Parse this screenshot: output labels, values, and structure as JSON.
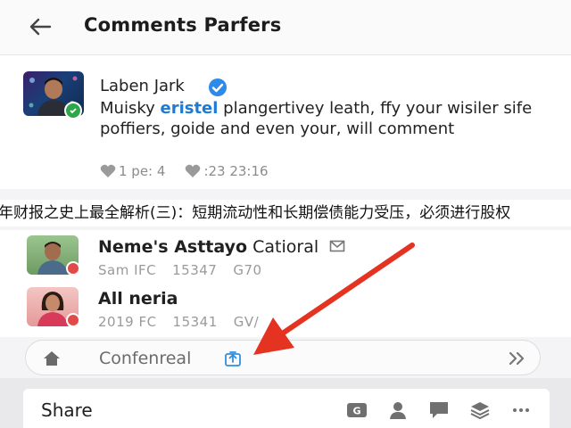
{
  "header": {
    "title": "Comments Parfers"
  },
  "comment": {
    "author": "Laben Jark",
    "body_before": "Muisky ",
    "body_highlight": "eristel",
    "body_after": " plangertivey leath, ffy your wisiler sife poffiers, goide and even your, will comment",
    "likes": "1 pe: 4",
    "hearts": ":23 23:16"
  },
  "banner": {
    "text": "年财报之史上最全解析(三)：短期流动性和长期偿债能力受压，必须进行股权"
  },
  "replies": [
    {
      "name_bold": "Neme's Asttayo",
      "name_rest": " Catioral",
      "meta": [
        "Sam IFC",
        "15347",
        "G70"
      ]
    },
    {
      "name_bold": "All neria",
      "name_rest": "",
      "meta": [
        "2019 FC",
        "15341",
        "GV/"
      ]
    }
  ],
  "input": {
    "value": "Confenreal"
  },
  "share": {
    "label": "Share"
  },
  "colors": {
    "accent_blue": "#1f7ad6",
    "verified_blue": "#2d8ae8",
    "arrow_red": "#e53322",
    "badge_green": "#2ea64a"
  },
  "icons": [
    "back-arrow-icon",
    "verified-icon",
    "heart-icon",
    "home-icon",
    "upload-icon",
    "double-chevron-right-icon",
    "g-icon",
    "person-icon",
    "chat-icon",
    "layers-icon",
    "more-icon"
  ]
}
